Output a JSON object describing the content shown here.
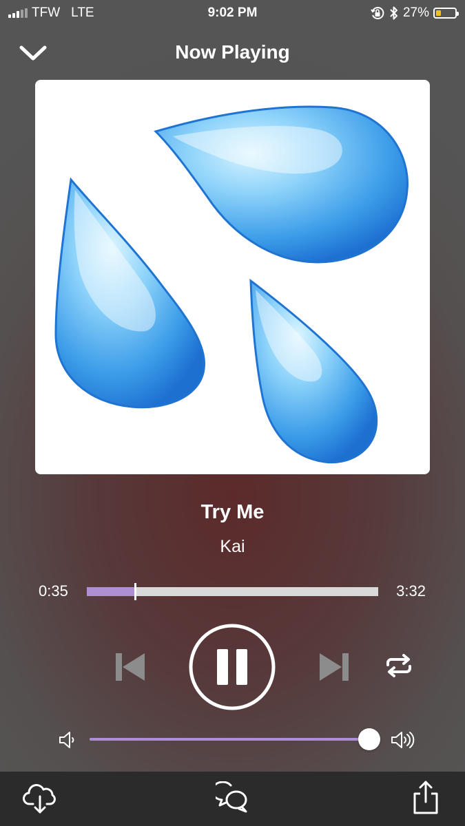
{
  "status_bar": {
    "carrier": "TFW",
    "network": "LTE",
    "time": "9:02 PM",
    "battery_percent_label": "27%",
    "battery_level": 0.27,
    "signal_bars_active": 3,
    "signal_bars_total": 5,
    "icons": [
      "orientation-lock-icon",
      "bluetooth-icon",
      "battery-icon"
    ]
  },
  "header": {
    "title": "Now Playing",
    "collapse_icon": "chevron-down-icon"
  },
  "track": {
    "title": "Try Me",
    "artist": "Kai",
    "artwork": "sweat-droplets-emoji"
  },
  "progress": {
    "elapsed": "0:35",
    "total": "3:32",
    "fraction": 0.165
  },
  "controls": {
    "previous_icon": "skip-previous-icon",
    "pause_icon": "pause-icon",
    "next_icon": "skip-next-icon",
    "repeat_icon": "repeat-icon"
  },
  "volume": {
    "level": 1.0,
    "low_icon": "volume-low-icon",
    "high_icon": "volume-high-icon"
  },
  "bottom_bar": {
    "download_icon": "cloud-download-icon",
    "chat_icon": "chat-bubbles-icon",
    "share_icon": "share-icon"
  },
  "colors": {
    "accent": "#ae8fd4",
    "battery": "#f2c01d",
    "bottom_bar": "#2b2b2b",
    "droplet": "#3a9be8"
  }
}
